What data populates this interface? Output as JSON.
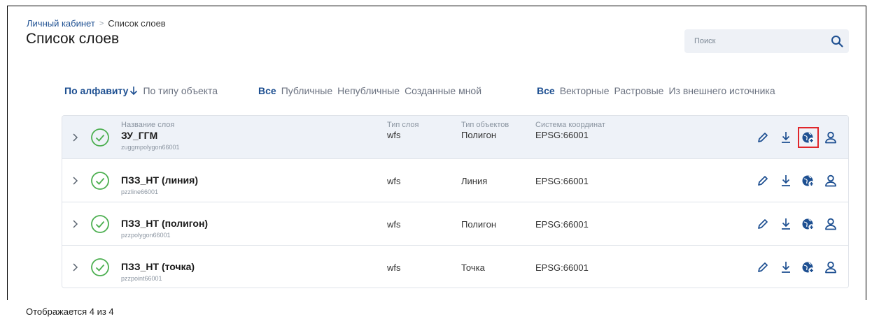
{
  "breadcrumb": {
    "root": "Личный кабинет",
    "separator": ">",
    "current": "Список слоев"
  },
  "page_title": "Список слоев",
  "search": {
    "placeholder": "Поиск",
    "value": ""
  },
  "filters": {
    "sort": [
      {
        "label": "По алфавиту",
        "active": true
      },
      {
        "label": "По типу объекта",
        "active": false
      }
    ],
    "visibility": [
      {
        "label": "Все",
        "active": true
      },
      {
        "label": "Публичные",
        "active": false
      },
      {
        "label": "Непубличные",
        "active": false
      },
      {
        "label": "Созданные мной",
        "active": false
      }
    ],
    "source": [
      {
        "label": "Все",
        "active": true
      },
      {
        "label": "Векторные",
        "active": false
      },
      {
        "label": "Растровые",
        "active": false
      },
      {
        "label": "Из внешнего источника",
        "active": false
      }
    ]
  },
  "table": {
    "headers": {
      "name": "Название слоя",
      "type": "Тип слоя",
      "object_type": "Тип объектов",
      "crs": "Система координат"
    },
    "rows": [
      {
        "name": "ЗУ_ГГМ",
        "id": "zuggmpolygon66001",
        "type": "wfs",
        "object_type": "Полигон",
        "crs": "EPSG:66001"
      },
      {
        "name": "ПЗЗ_НТ (линия)",
        "id": "pzzline66001",
        "type": "wfs",
        "object_type": "Линия",
        "crs": "EPSG:66001"
      },
      {
        "name": "ПЗЗ_НТ (полигон)",
        "id": "pzzpolygon66001",
        "type": "wfs",
        "object_type": "Полигон",
        "crs": "EPSG:66001"
      },
      {
        "name": "ПЗЗ_НТ (точка)",
        "id": "pzzpoint66001",
        "type": "wfs",
        "object_type": "Точка",
        "crs": "EPSG:66001"
      }
    ]
  },
  "icons": {
    "search": "search-icon",
    "expand": "chevron-right-icon",
    "status": "check-circle-icon",
    "edit": "pencil-icon",
    "download": "download-icon",
    "publish": "globe-plus-icon",
    "owner": "user-icon"
  },
  "colors": {
    "accent": "#1d4f91",
    "status_ok": "#4caf50",
    "highlight": "#e0262b"
  },
  "footer": {
    "count_text": "Отображается 4 из 4"
  }
}
